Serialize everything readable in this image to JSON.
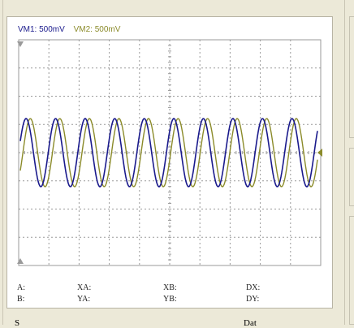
{
  "legend": {
    "ch1": {
      "label": "VM1: 500mV",
      "color": "#1a1a8c"
    },
    "ch2": {
      "label": "VM2: 500mV",
      "color": "#8b8b2a"
    }
  },
  "readouts": {
    "a": "A:",
    "b": "B:",
    "xa": "XA:",
    "ya": "YA:",
    "xb": "XB:",
    "yb": "YB:",
    "dx": "DX:",
    "dy": "DY:"
  },
  "bottom": {
    "left": "S",
    "right": "Dat"
  },
  "icons": {
    "marker_left_top": "triangle-down-icon",
    "marker_left_bottom": "triangle-up-icon",
    "ground_marker": "ground-arrow-icon"
  },
  "colors": {
    "grid": "#9a9a9a",
    "ch1": "#1a1a8c",
    "ch2": "#8b8b2a"
  },
  "chart_data": {
    "type": "line",
    "title": "",
    "series": [
      {
        "name": "VM1",
        "waveform": "sine",
        "cycles_visible": 10
      },
      {
        "name": "VM2",
        "waveform": "sine",
        "cycles_visible": 10
      }
    ]
  }
}
